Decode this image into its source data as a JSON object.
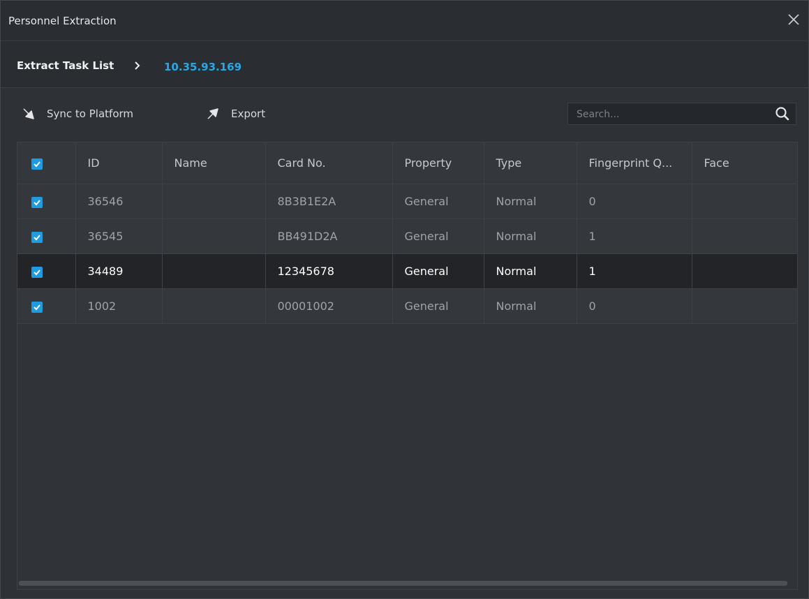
{
  "window": {
    "title": "Personnel Extraction"
  },
  "breadcrumb": {
    "root": "Extract Task List",
    "current": "10.35.93.169"
  },
  "toolbar": {
    "sync_label": "Sync to Platform",
    "export_label": "Export",
    "search_placeholder": "Search...",
    "search_value": ""
  },
  "table": {
    "columns": [
      "ID",
      "Name",
      "Card No.",
      "Property",
      "Type",
      "Fingerprint Q...",
      "Face"
    ],
    "header_checked": true,
    "rows": [
      {
        "checked": true,
        "selected": false,
        "id": "36546",
        "name": "",
        "card": "8B3B1E2A",
        "property": "General",
        "type": "Normal",
        "fingerprint": "0",
        "face": ""
      },
      {
        "checked": true,
        "selected": false,
        "id": "36545",
        "name": "",
        "card": "BB491D2A",
        "property": "General",
        "type": "Normal",
        "fingerprint": "1",
        "face": ""
      },
      {
        "checked": true,
        "selected": true,
        "id": "34489",
        "name": "",
        "card": "12345678",
        "property": "General",
        "type": "Normal",
        "fingerprint": "1",
        "face": ""
      },
      {
        "checked": true,
        "selected": false,
        "id": "1002",
        "name": "",
        "card": "00001002",
        "property": "General",
        "type": "Normal",
        "fingerprint": "0",
        "face": ""
      }
    ]
  },
  "colors": {
    "accent": "#1f9be0",
    "link": "#29a8e6",
    "background": "#2e3136",
    "selected_row": "#222428"
  },
  "icons": {
    "close": "close-icon",
    "breadcrumb_sep": "chevron-right-icon",
    "sync": "arrow-down-right-icon",
    "export": "arrow-up-right-icon",
    "search": "search-icon",
    "check": "checkmark-icon"
  }
}
